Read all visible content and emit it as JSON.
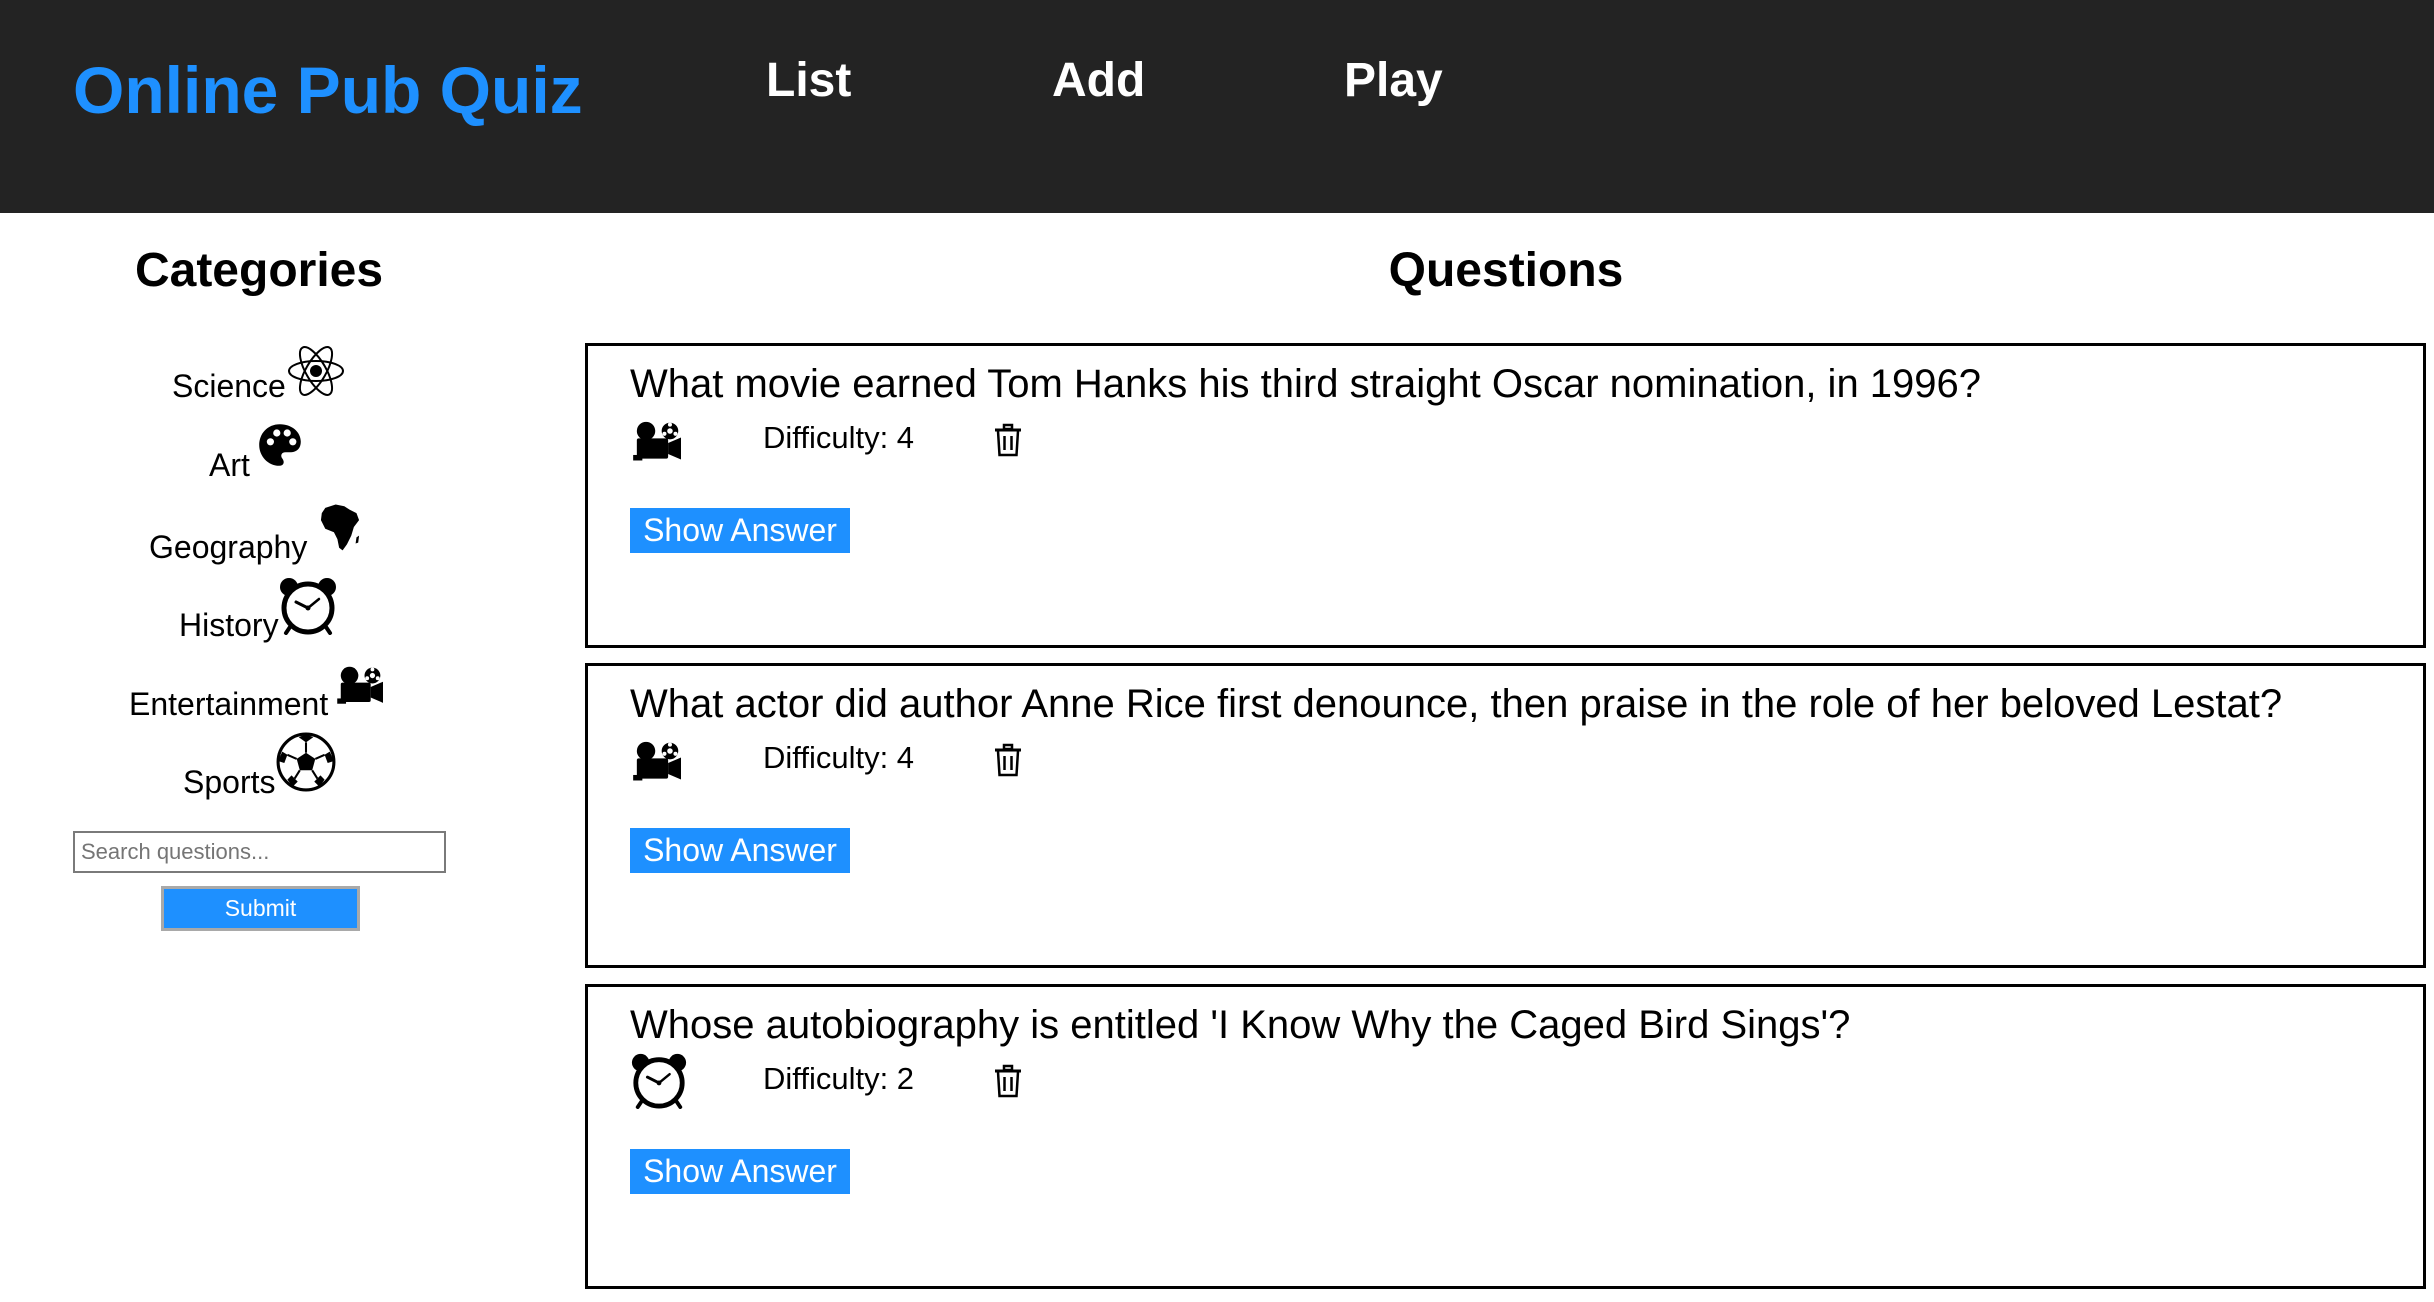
{
  "header": {
    "brand": "Online Pub Quiz",
    "nav": [
      {
        "label": "List"
      },
      {
        "label": "Add"
      },
      {
        "label": "Play"
      }
    ]
  },
  "sidebar": {
    "title": "Categories",
    "categories": [
      {
        "label": "Science",
        "icon": "atom-icon"
      },
      {
        "label": "Art",
        "icon": "palette-icon"
      },
      {
        "label": "Geography",
        "icon": "africa-icon"
      },
      {
        "label": "History",
        "icon": "alarm-clock-icon"
      },
      {
        "label": "Entertainment",
        "icon": "film-projector-icon"
      },
      {
        "label": "Sports",
        "icon": "soccer-ball-icon"
      }
    ],
    "search": {
      "placeholder": "Search questions...",
      "value": ""
    },
    "submit_label": "Submit"
  },
  "main": {
    "title": "Questions",
    "questions": [
      {
        "text": "What movie earned Tom Hanks his third straight Oscar nomination, in 1996?",
        "difficulty": "Difficulty: 4",
        "category_icon": "film-projector-icon",
        "show_answer_label": "Show Answer"
      },
      {
        "text": "What actor did author Anne Rice first denounce, then praise in the role of her beloved Lestat?",
        "difficulty": "Difficulty: 4",
        "category_icon": "film-projector-icon",
        "show_answer_label": "Show Answer"
      },
      {
        "text": "Whose autobiography is entitled 'I Know Why the Caged Bird Sings'?",
        "difficulty": "Difficulty: 2",
        "category_icon": "alarm-clock-icon",
        "show_answer_label": "Show Answer"
      }
    ]
  },
  "colors": {
    "accent": "#1e90ff",
    "header_bg": "#232323"
  }
}
